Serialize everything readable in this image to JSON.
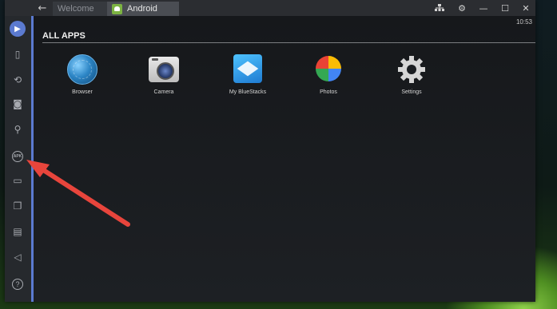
{
  "tabs": [
    {
      "label": "Welcome",
      "active": false
    },
    {
      "label": "Android",
      "active": true
    }
  ],
  "titlebar_icons": [
    "back-arrow-icon",
    "network-icon",
    "gear-icon",
    "minimize-icon",
    "maximize-icon",
    "close-icon"
  ],
  "screen": {
    "clock": "10:53",
    "section_title": "ALL APPS",
    "apps": [
      {
        "label": "Browser",
        "icon": "browser-icon"
      },
      {
        "label": "Camera",
        "icon": "camera-icon"
      },
      {
        "label": "My BlueStacks",
        "icon": "bluestacks-icon"
      },
      {
        "label": "Photos",
        "icon": "photos-icon"
      },
      {
        "label": "Settings",
        "icon": "settings-icon"
      }
    ]
  },
  "sidebar": {
    "items": [
      {
        "name": "video-call-icon"
      },
      {
        "name": "portrait-landscape-icon"
      },
      {
        "name": "rotate-icon"
      },
      {
        "name": "camera-icon"
      },
      {
        "name": "location-icon"
      },
      {
        "name": "apk-icon",
        "label": "APK"
      },
      {
        "name": "folder-icon"
      },
      {
        "name": "copy-icon"
      },
      {
        "name": "paste-icon"
      },
      {
        "name": "volume-icon"
      },
      {
        "name": "help-icon",
        "label": "?"
      }
    ]
  },
  "annotation": {
    "color": "#e8453c",
    "target": "apk-icon"
  },
  "colors": {
    "accent": "#5b7ad0",
    "window_bg": "#1b1e22",
    "titlebar_bg": "#2b2d31"
  }
}
